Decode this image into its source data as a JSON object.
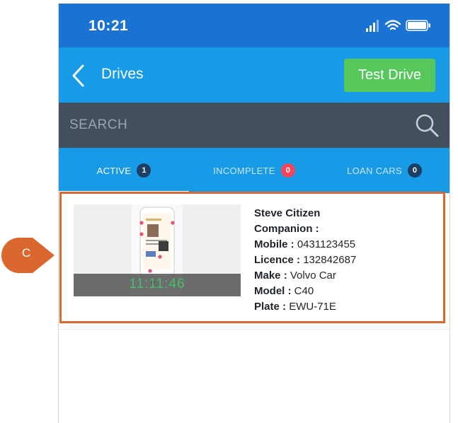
{
  "statusbar": {
    "time": "10:21"
  },
  "header": {
    "title": "Drives",
    "test_drive_label": "Test Drive"
  },
  "search": {
    "placeholder": "SEARCH"
  },
  "tabs": [
    {
      "label": "ACTIVE",
      "count": "1",
      "active": true
    },
    {
      "label": "INCOMPLETE",
      "count": "0",
      "active": false
    },
    {
      "label": "LOAN CARS",
      "count": "0",
      "active": false
    }
  ],
  "drive_card": {
    "thumbnail_time": "11:11:46",
    "name": "Steve Citizen",
    "companion_label": "Companion :",
    "companion_value": "",
    "mobile_label": "Mobile :",
    "mobile_value": "0431123455",
    "licence_label": "Licence :",
    "licence_value": "132842687",
    "make_label": "Make :",
    "make_value": "Volvo Car",
    "model_label": "Model :",
    "model_value": "C40",
    "plate_label": "Plate :",
    "plate_value": "EWU-71E"
  },
  "annotation": {
    "callout_label": "C",
    "callout_color": "#d9672e"
  },
  "colors": {
    "status_bar": "#1a73d2",
    "header": "#179be6",
    "search_bar": "#434f5d",
    "button": "#56c85b",
    "badge_red": "#f2445b",
    "badge_dark": "#1d3f63",
    "highlight_border": "#d9672e"
  },
  "icons": {
    "back": "chevron-left-icon",
    "search": "search-icon",
    "signal": "signal-icon",
    "wifi": "wifi-icon",
    "battery": "battery-icon"
  }
}
